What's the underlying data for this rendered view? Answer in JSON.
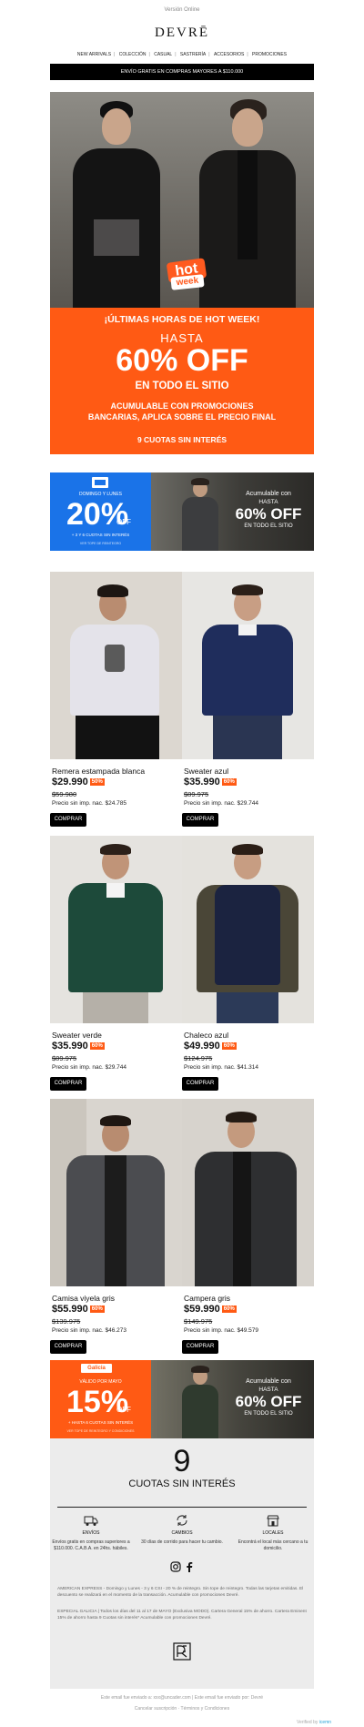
{
  "header": {
    "online_link": "Versión Online",
    "logo": "DEVRĒ",
    "nav": [
      "NEW ARRIVALS",
      "COLECCIÓN",
      "CASUAL",
      "SASTRERÍA",
      "ACCESORIOS",
      "PROMOCIONES"
    ],
    "shipping_bar": "ENVÍO GRATIS EN COMPRAS MAYORES A $110.000"
  },
  "hero": {
    "badge_hot": "hot",
    "badge_week": "week"
  },
  "promo": {
    "headline": "¡ÚLTIMAS HORAS DE HOT WEEK!",
    "hasta": "HASTA",
    "off": "60% OFF",
    "sitio": "EN TODO EL SITIO",
    "acumulable_1": "ACUMULABLE CON PROMOCIONES",
    "acumulable_2": "BANCARIAS, APLICA SOBRE EL PRECIO FINAL",
    "cuotas": "9 CUOTAS SIN INTERÉS",
    "color": "#ff5a14"
  },
  "bank_banner_1": {
    "day": "DOMINGO Y LUNES",
    "pct": "20%",
    "off": "OFF",
    "cuotas": "+ 3 Y 6 CUOTAS SIN INTERÉS",
    "tope": "VER TOPE DE REINTEGRO",
    "acumulable": "Acumulable con",
    "hasta": "HASTA",
    "off_big": "60% OFF",
    "sitio": "EN TODO EL SITIO",
    "color": "#1a73e8"
  },
  "bank_banner_2": {
    "tag": "Galicia",
    "day": "VÁLIDO POR MAYO",
    "pct": "15%",
    "off": "OFF",
    "cuotas": "+ HASTA 6 CUOTAS SIN INTERÉS",
    "tope": "VER TOPE DE REINTEGRO Y CONDICIONES",
    "acumulable": "Acumulable con",
    "hasta": "HASTA",
    "off_big": "60% OFF",
    "sitio": "EN TODO EL SITIO",
    "color": "#ff5a14"
  },
  "products": [
    {
      "name": "Remera estampada blanca",
      "price": "$29.990",
      "badge": "50%",
      "old": "$59.980",
      "net": "Precio sin imp. nac. $24.785",
      "button": "COMPRAR"
    },
    {
      "name": "Sweater azul",
      "price": "$35.990",
      "badge": "60%",
      "old": "$89.975",
      "net": "Precio sin imp. nac. $29.744",
      "button": "COMPRAR"
    },
    {
      "name": "Sweater verde",
      "price": "$35.990",
      "badge": "60%",
      "old": "$89.975",
      "net": "Precio sin imp. nac. $29.744",
      "button": "COMPRAR"
    },
    {
      "name": "Chaleco azul",
      "price": "$49.990",
      "badge": "60%",
      "old": "$124.975",
      "net": "Precio sin imp. nac. $41.314",
      "button": "COMPRAR"
    },
    {
      "name": "Camisa viyela gris",
      "price": "$55.990",
      "badge": "60%",
      "old": "$139.975",
      "net": "Precio sin imp. nac. $46.273",
      "button": "COMPRAR"
    },
    {
      "name": "Campera gris",
      "price": "$59.990",
      "badge": "60%",
      "old": "$149.975",
      "net": "Precio sin imp. nac. $49.579",
      "button": "COMPRAR"
    }
  ],
  "cuotas_block": {
    "nine": "9",
    "label": "CUOTAS SIN INTERÉS",
    "benefits": [
      {
        "icon": "truck-icon",
        "title": "ENVÍOS",
        "desc": "Envíos gratis en compras superiores a $110.000. C.A.B.A. en 24hs. hábiles."
      },
      {
        "icon": "exchange-icon",
        "title": "CAMBIOS",
        "desc": "30 días de corrido para hacer tu cambio."
      },
      {
        "icon": "store-icon",
        "title": "LOCALES",
        "desc": "Encontrá el local más cercano a tu domicilio."
      }
    ],
    "legal_1": "AMERICAN EXPRESS - Domingo y Lunes - 3 y 6 CSI - 20 % de reintegro. Sin tope de reintegro. Todas las tarjetas emitidas. El descuento se realizará en el momento de la transacción. Acumulable con promociones Devré.",
    "legal_2": "ESPECIAL GALICIA | Todos los días del 11 al 17 de MAYO (Exclusiva MODO). Cartera General 15% de ahorro. Cartera Eminent 15% de ahorro hasta 9 Cuotas sin interés* Acumulable con promociones Devré."
  },
  "footer": {
    "sent": "Este email fue enviado a: xxx@uncader.com | Este email fue enviado por: Devré",
    "unsub": "Cancelar suscripción · Términos y Condiciones",
    "verified_prefix": "Verified by",
    "verified_brand": "icemn"
  }
}
